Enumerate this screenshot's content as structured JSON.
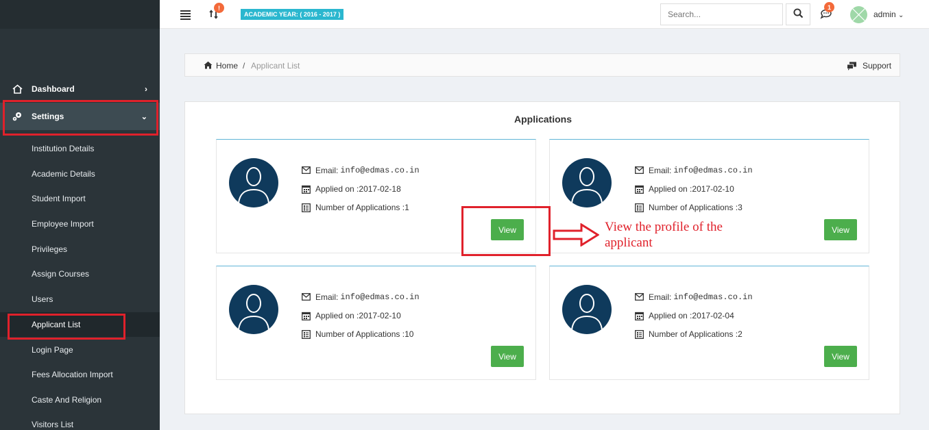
{
  "sidebar": {
    "top_items": [
      {
        "label": "Dashboard",
        "icon": "home-icon"
      },
      {
        "label": "Settings",
        "icon": "gears-icon"
      }
    ],
    "sub_items": [
      {
        "label": "Institution Details"
      },
      {
        "label": "Academic Details"
      },
      {
        "label": "Student Import"
      },
      {
        "label": "Employee Import"
      },
      {
        "label": "Privileges"
      },
      {
        "label": "Assign Courses"
      },
      {
        "label": "Users"
      },
      {
        "label": "Applicant List",
        "active": true
      },
      {
        "label": "Login Page"
      },
      {
        "label": "Fees Allocation Import"
      },
      {
        "label": "Caste And Religion"
      },
      {
        "label": "Visitors List"
      }
    ]
  },
  "topbar": {
    "sync_badge": "!",
    "academic_year": "ACADEMIC YEAR: ( 2016 - 2017 )",
    "search_placeholder": "Search...",
    "chat_badge": "1",
    "user": "admin"
  },
  "breadcrumb": {
    "home": "Home",
    "separator": "/",
    "current": "Applicant List",
    "support": "Support"
  },
  "applications": {
    "title": "Applications",
    "email_label": "Email:",
    "applied_label": "Applied on :",
    "count_label": "Number of Applications :",
    "view_label": "View",
    "cards": [
      {
        "email": "info@edmas.co.in",
        "applied_on": "2017-02-18",
        "applications": "1"
      },
      {
        "email": "info@edmas.co.in",
        "applied_on": "2017-02-10",
        "applications": "3"
      },
      {
        "email": "info@edmas.co.in",
        "applied_on": "2017-02-10",
        "applications": "10"
      },
      {
        "email": "info@edmas.co.in",
        "applied_on": "2017-02-04",
        "applications": "2"
      }
    ]
  },
  "annotation": {
    "text": "View the profile of the applicant"
  },
  "colors": {
    "sidebar_bg": "#2b3439",
    "accent_cyan": "#2bb7cf",
    "badge_orange": "#f36a3a",
    "view_green": "#4cae4c",
    "annotation_red": "#e0212b",
    "avatar_navy": "#0f3a5c"
  }
}
